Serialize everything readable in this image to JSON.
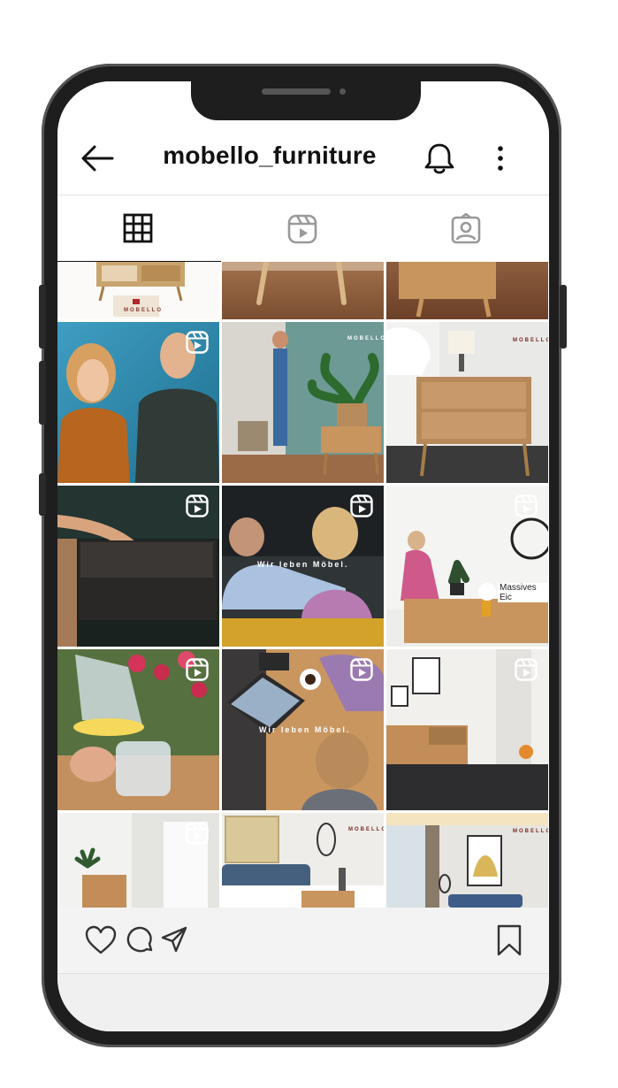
{
  "header": {
    "title": "mobello_furniture",
    "back_icon": "arrow-left-icon",
    "notification_icon": "bell-icon",
    "menu_icon": "more-vertical-icon"
  },
  "tabs": [
    {
      "name": "grid-icon",
      "active": true
    },
    {
      "name": "reels-icon",
      "active": false
    },
    {
      "name": "tagged-icon",
      "active": false
    }
  ],
  "posts": {
    "brand_mark": "MOBELLO",
    "overlay_1": "Wir leben Möbel.",
    "overlay_2": "Wir leben Möbel.",
    "overlay_3": "Massives Eic"
  },
  "actions": {
    "like_icon": "heart-icon",
    "comment_icon": "comment-icon",
    "share_icon": "send-icon",
    "save_icon": "bookmark-icon"
  },
  "colors": {
    "frame": "#1e1e1e",
    "text": "#111111",
    "surface": "#ffffff"
  }
}
